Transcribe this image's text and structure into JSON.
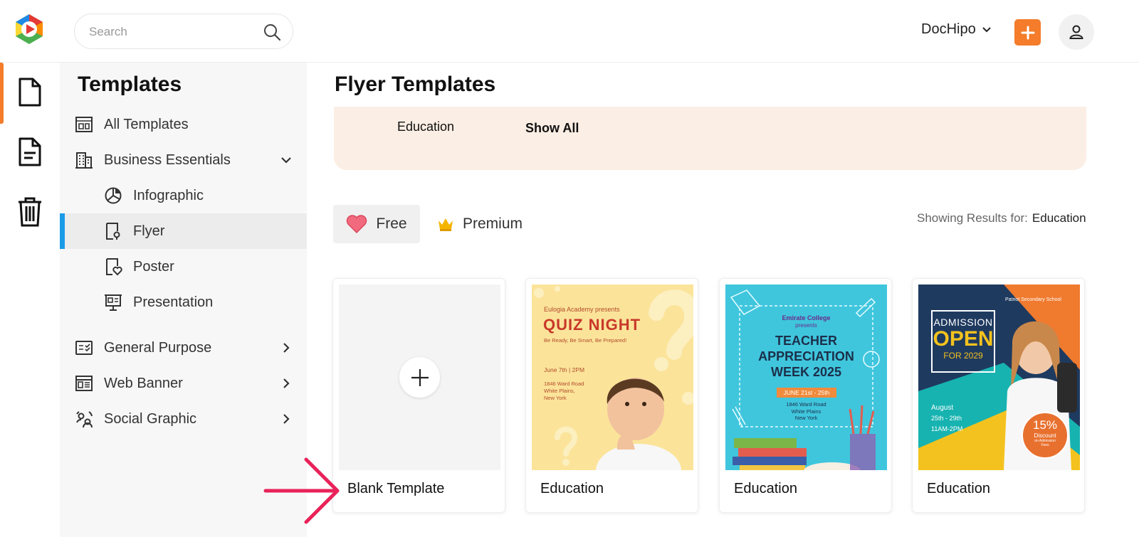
{
  "header": {
    "search": {
      "placeholder": "Search"
    },
    "brand_menu": "DocHipo",
    "accent_color": "#f47c2a"
  },
  "rail": {
    "items": [
      {
        "icon": "document-icon",
        "active": true
      },
      {
        "icon": "text-document-icon",
        "active": false
      },
      {
        "icon": "trash-icon",
        "active": false
      }
    ]
  },
  "sidebar": {
    "title": "Templates",
    "items": [
      {
        "label": "All Templates",
        "icon": "grid-layout-icon"
      },
      {
        "label": "Business Essentials",
        "icon": "building-icon",
        "expanded": true
      },
      {
        "label": "Infographic",
        "icon": "pie-chart-icon"
      },
      {
        "label": "Flyer",
        "icon": "flyer-icon",
        "selected": true
      },
      {
        "label": "Poster",
        "icon": "poster-icon"
      },
      {
        "label": "Presentation",
        "icon": "presentation-icon"
      },
      {
        "label": "General Purpose",
        "icon": "checklist-icon"
      },
      {
        "label": "Web Banner",
        "icon": "web-banner-icon"
      },
      {
        "label": "Social Graphic",
        "icon": "social-icon"
      }
    ],
    "selected_color": "#1a9be8"
  },
  "main": {
    "title": "Flyer Templates",
    "categories": [
      "Education",
      "Show All"
    ],
    "filters": {
      "free": "Free",
      "premium": "Premium"
    },
    "results_label": "Showing Results for:",
    "results_value": "Education",
    "cards": [
      {
        "caption": "Blank Template"
      },
      {
        "caption": "Education",
        "flyer": {
          "presenter": "Eulogia Academy presents",
          "headline": "QUIZ NIGHT",
          "tagline": "Be Ready, Be Smart, Be Prepared!",
          "date": "June 7th | 2PM",
          "address": [
            "1846 Ward Road",
            "White Plains,",
            "New York"
          ]
        }
      },
      {
        "caption": "Education",
        "flyer": {
          "presenter": "Emirate College",
          "presenter2": "presents",
          "headline": [
            "TEACHER",
            "APPRECIATION",
            "WEEK 2025"
          ],
          "dates": "JUNE 21st - 25th",
          "address": [
            "1846 Ward Road",
            "White Plains",
            "New York"
          ]
        }
      },
      {
        "caption": "Education",
        "flyer": {
          "school": "Patriot Secondary School",
          "headline1": "ADMISSION",
          "headline2": "OPEN",
          "headline3": "FOR 2029",
          "month": "August",
          "dates": "25th - 29th",
          "time": "11AM-2PM",
          "discount": "15%",
          "discount_label": "Discount",
          "discount_note": "on Admission Fees"
        }
      }
    ]
  }
}
